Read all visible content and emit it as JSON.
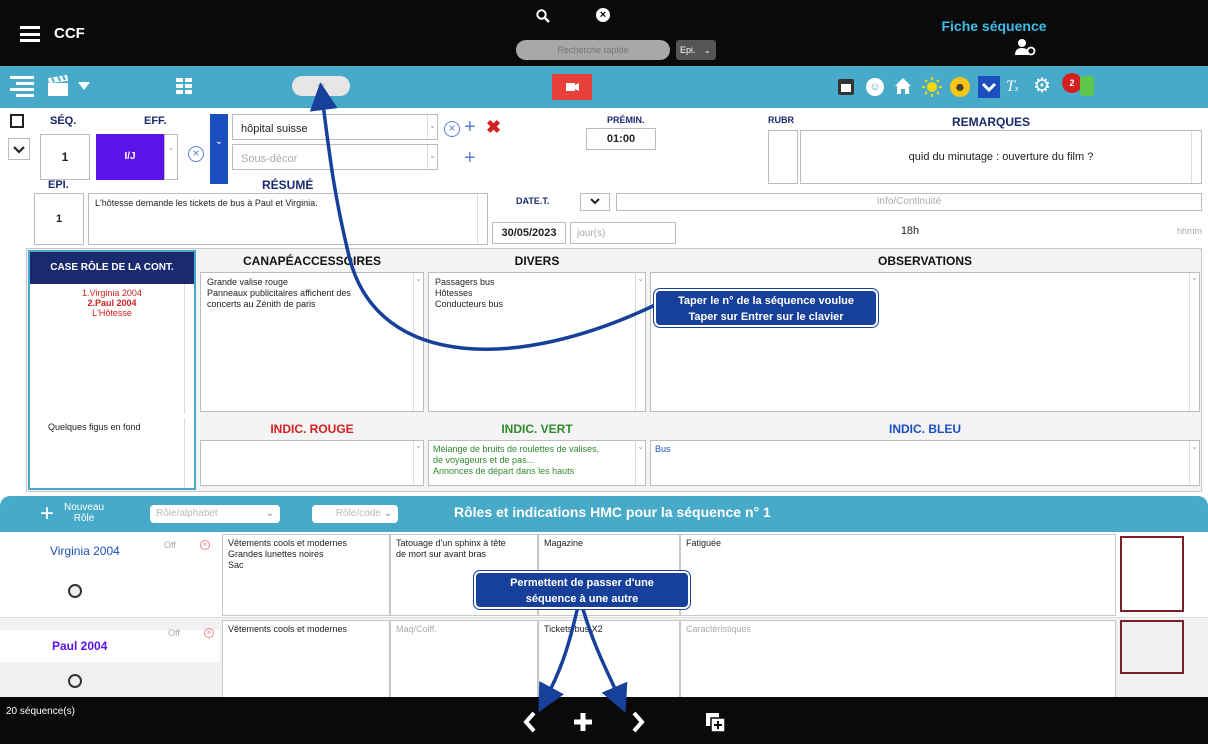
{
  "topbar": {
    "app_title": "CCF",
    "search_placeholder": "Recherche rapide",
    "epi_select": "Epi.",
    "page_title": "Fiche séquence"
  },
  "toolbar": {
    "notification_count": "2"
  },
  "sequence": {
    "seq_label": "SÉQ.",
    "seq_number": "1",
    "eff_label": "EFF.",
    "eff_value": "I/J",
    "decor_value": "hôpital suisse",
    "sous_decor_placeholder": "Sous-décor",
    "premin_label": "PRÉMIN.",
    "premin_value": "01:00",
    "rubr_label": "RUBR",
    "remarques_label": "REMARQUES",
    "remarques_value": "quid du minutage : ouverture du film ?",
    "epi_label": "EPI.",
    "epi_value": "1",
    "resume_label": "RÉSUMÉ",
    "resume_value": "L'hôtesse demande les tickets de bus à Paul et Virginia.",
    "datet_label": "DATE.T.",
    "datet_value": "30/05/2023",
    "jour_placeholder": "jour(s)",
    "info_placeholder": "Info/Continuité",
    "time_value": "18h",
    "hhmm_placeholder": "hhmm"
  },
  "panels": {
    "case_role_header": "CASE RÔLE DE LA CONT.",
    "roles": [
      "1.Virginia 2004",
      "2.Paul 2004",
      "L'Hôtesse"
    ],
    "figurants": "Quelques figus en fond",
    "accessoires_header": "CANAPÉACCESSOIRES",
    "accessoires_lines": [
      "Grande valise rouge",
      "Panneaux publicitaires affichent des",
      "concerts au Zénith de paris"
    ],
    "divers_header": "DIVERS",
    "divers_lines": [
      "Passagers bus",
      "Hôtesses",
      "Conducteurs bus"
    ],
    "observations_header": "OBSERVATIONS",
    "indic_rouge_header": "INDIC. ROUGE",
    "indic_vert_header": "INDIC. VERT",
    "indic_vert_lines": [
      "Mélange de bruits de roulettes de valises,",
      "de voyageurs et de pas...",
      "Annonces de départ dans les hauts"
    ],
    "indic_bleu_header": "INDIC. BLEU",
    "indic_bleu_value": "Bus"
  },
  "callouts": {
    "callout1_line1": "Taper le n° de la séquence voulue",
    "callout1_line2": "Taper sur Entrer sur le clavier",
    "callout2_line1": "Permettent de passer d'une",
    "callout2_line2": "séquence à une autre"
  },
  "roles_bar": {
    "nouveau_line1": "Nouveau",
    "nouveau_line2": "Rôle",
    "role_alphabet_placeholder": "Rôle/alphabet",
    "role_code_placeholder": "Rôle/code",
    "title": "Rôles et indications HMC pour la séquence n° 1"
  },
  "role_rows": [
    {
      "name": "Virginia 2004",
      "status": "Off",
      "costume_lines": [
        "Vêtements cools et modernes",
        "Grandes lunettes noires",
        "Sac"
      ],
      "makeup_lines": [
        "Tatouage d'un sphinx à tête",
        "de mort sur avant bras"
      ],
      "makeup_placeholder": "",
      "accessory": "Magazine",
      "character": "Fatiguée",
      "character_placeholder": ""
    },
    {
      "name": "Paul 2004",
      "status": "Off",
      "costume_lines": [
        "Vêtements cools et modernes"
      ],
      "makeup_lines": [],
      "makeup_placeholder": "Maq/Coiff.",
      "accessory": "Tickets bus X2",
      "character": "",
      "character_placeholder": "Caractéristiques"
    }
  ],
  "bottombar": {
    "sequence_count": "20 séquence(s)"
  },
  "colors": {
    "accent": "#48aac9",
    "callout": "#17409a",
    "eff_purple": "#5b13e8",
    "red": "#d32020",
    "green": "#2e8b2e",
    "blue": "#1b4fbf",
    "frame": "#7a1e2a"
  }
}
